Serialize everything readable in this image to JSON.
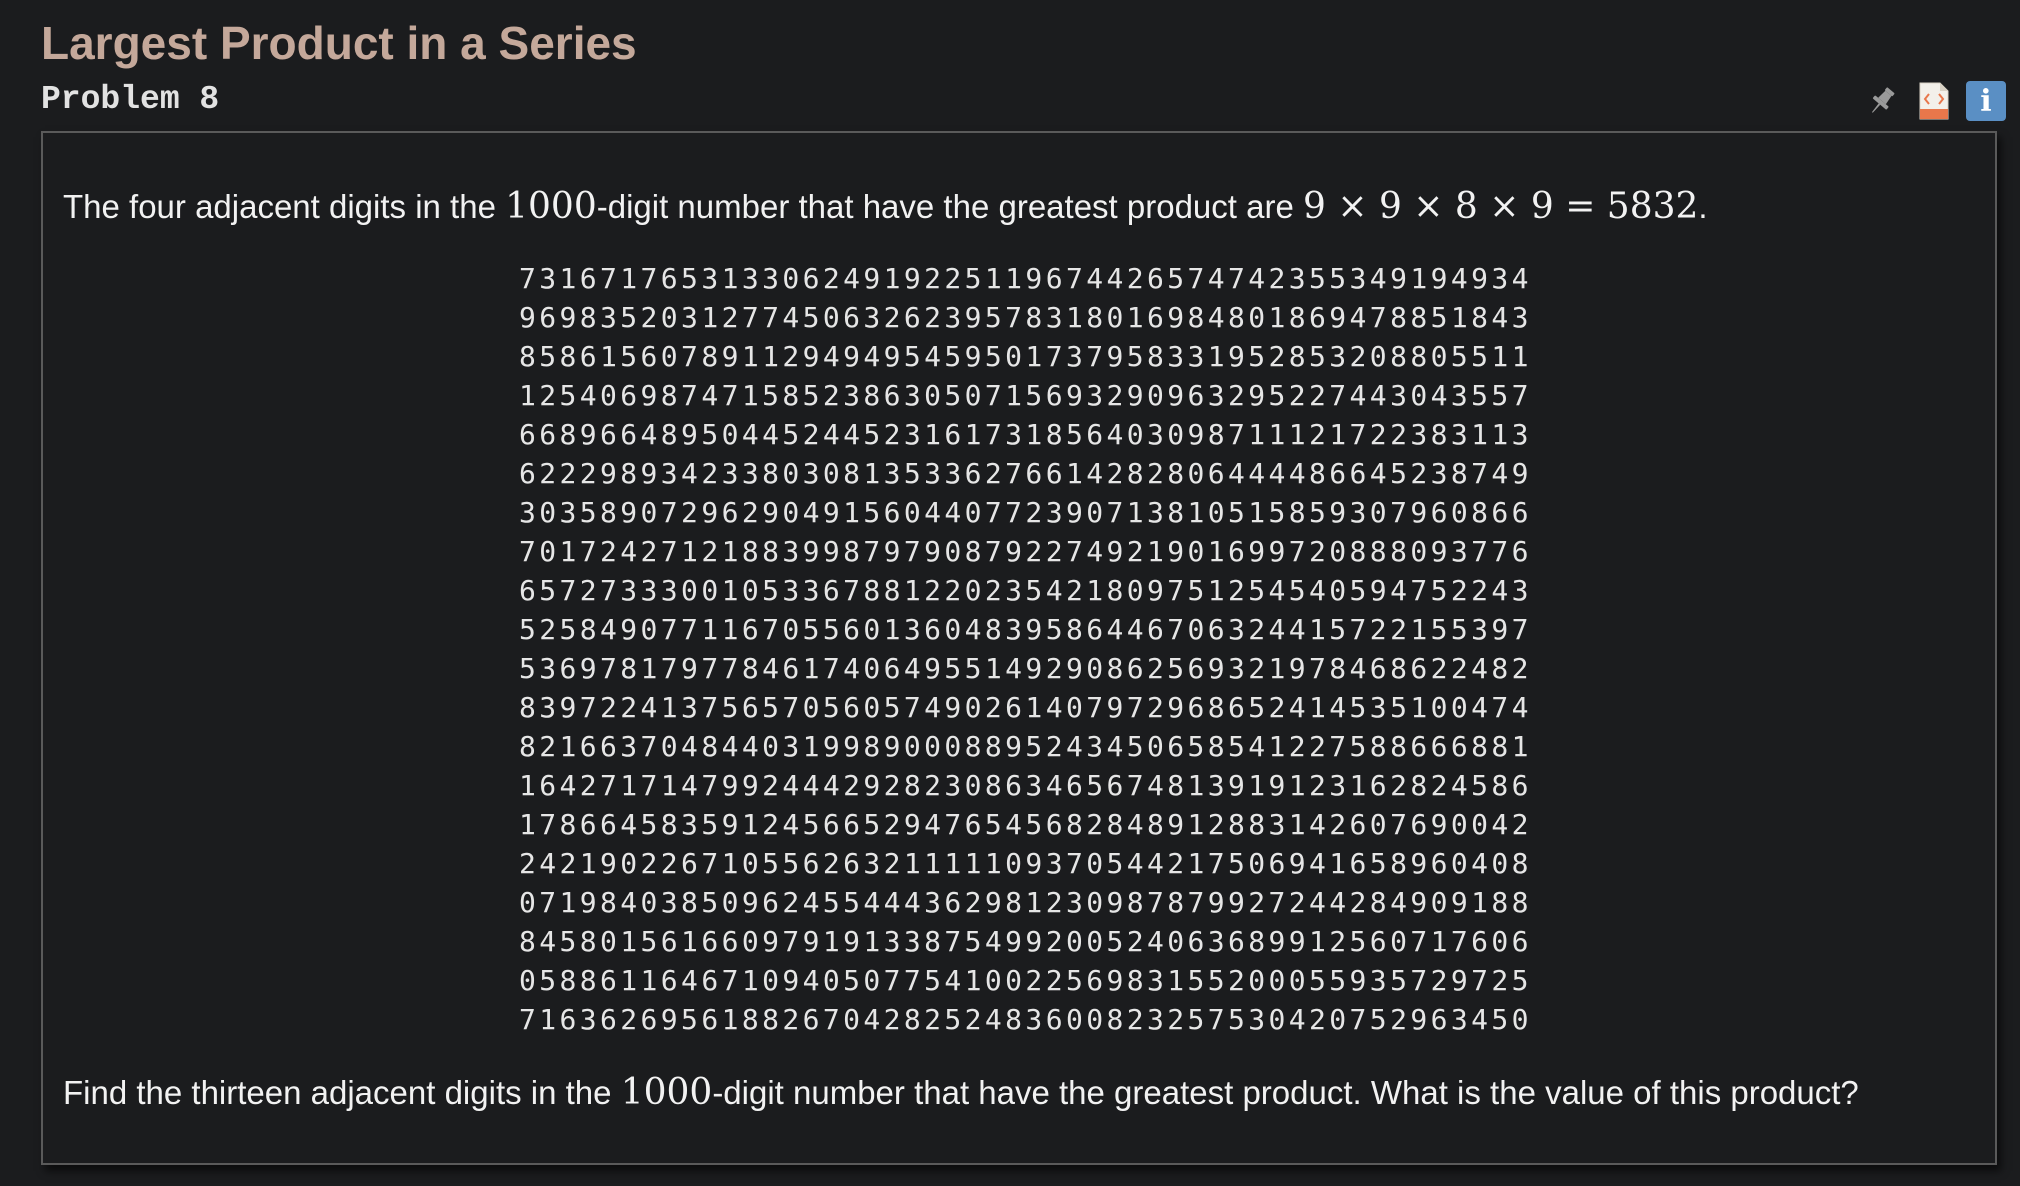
{
  "page": {
    "title": "Largest Product in a Series",
    "problem_number": "Problem 8"
  },
  "toolbar": {
    "icons": [
      "pin-icon",
      "html-icon",
      "info-icon"
    ],
    "html_icon_label": "HTML",
    "info_icon_glyph": "i"
  },
  "colors": {
    "title": "#c4a89a",
    "background": "#1b1c1e",
    "info_badge": "#5a8fc4",
    "html_icon": "#e8774b",
    "pin_icon": "#9a9a9a"
  },
  "intro": {
    "text_before": "The four adjacent digits in the ",
    "number_term": "1000",
    "text_middle": "-digit number that have the greatest product are ",
    "equation": "9 × 9 × 8 × 9 = 5832",
    "text_after": "."
  },
  "digit_lines": [
    "73167176531330624919225119674426574742355349194934",
    "96983520312774506326239578318016984801869478851843",
    "85861560789112949495459501737958331952853208805511",
    "12540698747158523863050715693290963295227443043557",
    "66896648950445244523161731856403098711121722383113",
    "62229893423380308135336276614282806444486645238749",
    "30358907296290491560440772390713810515859307960866",
    "70172427121883998797908792274921901699720888093776",
    "65727333001053367881220235421809751254540594752243",
    "52584907711670556013604839586446706324415722155397",
    "53697817977846174064955149290862569321978468622482",
    "83972241375657056057490261407972968652414535100474",
    "82166370484403199890008895243450658541227588666881",
    "16427171479924442928230863465674813919123162824586",
    "17866458359124566529476545682848912883142607690042",
    "24219022671055626321111109370544217506941658960408",
    "07198403850962455444362981230987879927244284909188",
    "84580156166097919133875499200524063689912560717606",
    "05886116467109405077541002256983155200055935729725",
    "71636269561882670428252483600823257530420752963450"
  ],
  "question": {
    "text_before": "Find the thirteen adjacent digits in the ",
    "number_term": "1000",
    "text_after": "-digit number that have the greatest product. What is the value of this product?"
  }
}
